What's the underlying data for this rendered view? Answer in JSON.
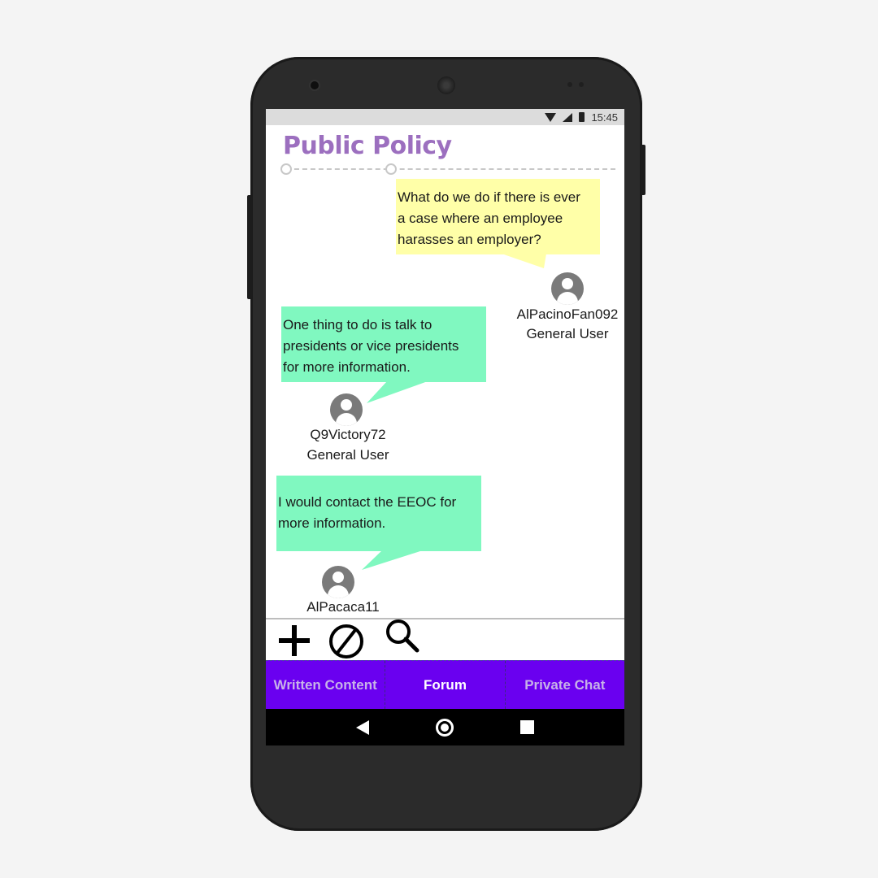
{
  "status_bar": {
    "time": "15:45"
  },
  "page": {
    "title": "Public Policy"
  },
  "posts": [
    {
      "text_lines": [
        "What do we do if there is ever",
        "a case where an employee",
        "harasses an employer?"
      ],
      "username": "AlPacinoFan092",
      "role": "General User",
      "bubble_color": "#ffffa8"
    },
    {
      "text_lines": [
        "One thing to do is talk to",
        "presidents or vice presidents",
        "for more information."
      ],
      "username": "Q9Victory72",
      "role": "General User",
      "bubble_color": "#80f8c0"
    },
    {
      "text_lines": [
        "I would contact the EEOC for",
        "more information."
      ],
      "username": "AlPacaca11",
      "bubble_color": "#80f8c0"
    }
  ],
  "toolbar": {
    "add_icon": "plus-icon",
    "block_icon": "prohibited-icon",
    "search_icon": "magnifier-icon"
  },
  "tabs": [
    {
      "label": "Written Content",
      "active": false
    },
    {
      "label": "Forum",
      "active": true
    },
    {
      "label": "Private Chat",
      "active": false
    }
  ],
  "colors": {
    "title": "#9c6fbf",
    "tab_bar": "#6a00f0",
    "avatar": "#7a7a7a"
  }
}
